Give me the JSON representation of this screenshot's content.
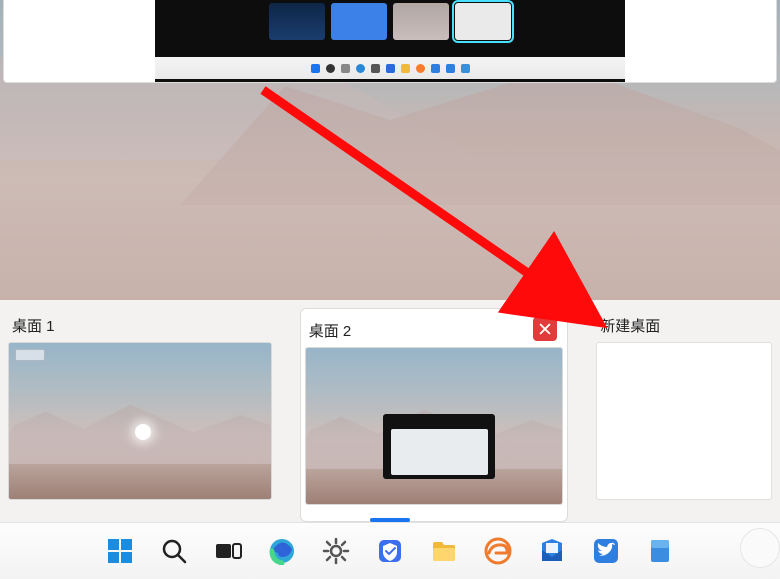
{
  "desktops": {
    "d1_label": "桌面 1",
    "d2_label": "桌面 2",
    "new_label": "新建桌面"
  },
  "icons": {
    "close": "close-icon",
    "start": "start-icon",
    "search": "search-icon",
    "taskview": "taskview-icon",
    "edge": "edge-icon",
    "settings": "settings-gear-icon",
    "shield": "security-shield-icon",
    "explorer": "file-explorer-icon",
    "edge_legacy": "edge-legacy-icon",
    "mail": "mail-icon",
    "bird": "bird-app-icon",
    "doc": "document-app-icon"
  },
  "colors": {
    "close_red": "#e23b3b",
    "arrow_red": "#ff0a0a",
    "accent_blue": "#1a74f0"
  }
}
